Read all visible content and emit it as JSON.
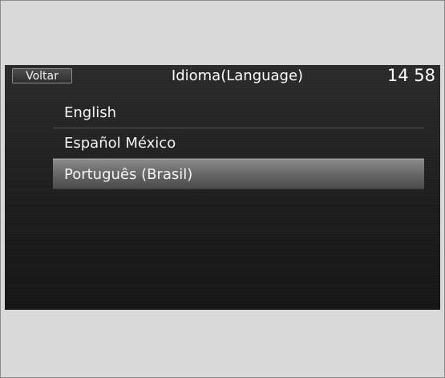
{
  "header": {
    "back_label": "Voltar",
    "title": "Idioma(Language)",
    "clock": "14 58"
  },
  "languages": [
    {
      "label": "English",
      "selected": false
    },
    {
      "label": "Español México",
      "selected": false
    },
    {
      "label": "Português (Brasil)",
      "selected": true
    }
  ],
  "colors": {
    "screen_background": "#1e1e1e",
    "text": "#ffffff",
    "selected_highlight": "#8a8a8a",
    "frame_background": "#d9d9d9"
  }
}
